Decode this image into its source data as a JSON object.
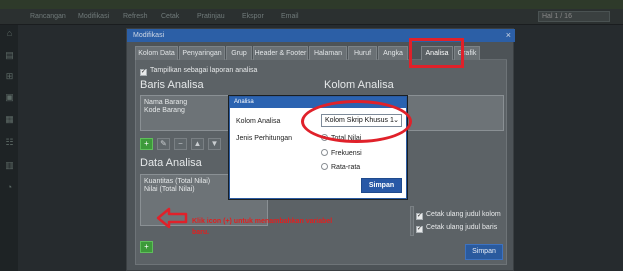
{
  "toolbar": {
    "items": [
      "Rancangan",
      "Modifikasi",
      "Refresh",
      "Cetak",
      "Pratinjau",
      "Ekspor",
      "Email"
    ],
    "search_value": "Hal 1 / 16"
  },
  "window": {
    "title": "Modifikasi",
    "close_label": "×",
    "tabs": [
      "Kolom Data",
      "Penyaringan",
      "Grup",
      "Header & Footer",
      "Halaman",
      "Huruf",
      "Angka",
      "Analisa",
      "Grafik"
    ],
    "active_tab": "Analisa",
    "show_as_analysis_label": "Tampilkan sebagai laporan analisa",
    "baris_analisa": {
      "heading": "Baris Analisa",
      "items": [
        "Nama Barang",
        "Kode Barang"
      ]
    },
    "kolom_analisa": {
      "heading": "Kolom Analisa"
    },
    "data_analisa": {
      "heading": "Data Analisa",
      "items": [
        "Kuantitas (Total Nilai)",
        "Nilai (Total Nilai)"
      ]
    },
    "options": {
      "reprint_column_title": "Cetak ulang judul kolom",
      "reprint_row_title": "Cetak ulang judul baris"
    },
    "save_label": "Simpan"
  },
  "dialog": {
    "title": "Analisa",
    "kolom_analisa_label": "Kolom Analisa",
    "kolom_analisa_value": "Kolom Skrip Khusus 1",
    "jenis_label": "Jenis Perhitungan",
    "radio_options": [
      "Total Nilai",
      "Frekuensi",
      "Rata-rata"
    ],
    "selected_option": "Total Nilai",
    "save_label": "Simpan"
  },
  "annotation": {
    "text": "Klik icon (+) untuk menambahkan variabel baru.",
    "color": "#e0212a"
  },
  "colors": {
    "title_bar": "#2c5fa6",
    "add_button": "#3d9a3a",
    "save_button": "#2858a6",
    "highlight": "#e0212a"
  }
}
